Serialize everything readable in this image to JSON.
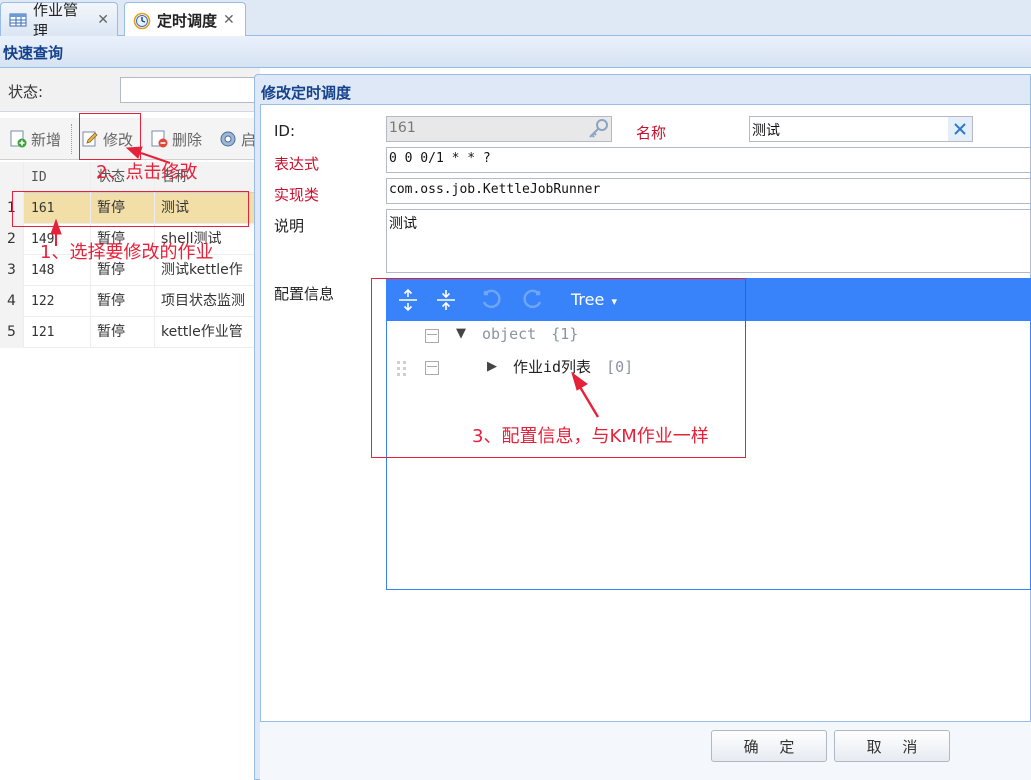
{
  "tabs": [
    {
      "label": "作业管理",
      "close": "✕",
      "icon": "grid-table-icon"
    },
    {
      "label": "定时调度",
      "close": "✕",
      "icon": "clock-icon",
      "active": true
    }
  ],
  "quick_query": {
    "title": "快速查询",
    "status_label": "状态:"
  },
  "toolbar": {
    "add_label": "新增",
    "edit_label": "修改",
    "delete_label": "删除",
    "start_label": "启"
  },
  "grid": {
    "columns": [
      "ID",
      "状态",
      "名称"
    ],
    "rows": [
      {
        "num": "1",
        "id": "161",
        "status": "暂停",
        "name": "测试",
        "selected": true
      },
      {
        "num": "2",
        "id": "149",
        "status": "暂停",
        "name": "shell测试"
      },
      {
        "num": "3",
        "id": "148",
        "status": "暂停",
        "name": "测试kettle作"
      },
      {
        "num": "4",
        "id": "122",
        "status": "暂停",
        "name": "项目状态监测"
      },
      {
        "num": "5",
        "id": "121",
        "status": "暂停",
        "name": "kettle作业管"
      }
    ]
  },
  "dialog": {
    "title": "修改定时调度",
    "id_label": "ID:",
    "id_value": "161",
    "name_label": "名称",
    "name_value": "测试",
    "expr_label": "表达式",
    "expr_value": "0 0 0/1 * * ?",
    "impl_label": "实现类",
    "impl_value": "com.oss.job.KettleJobRunner",
    "desc_label": "说明",
    "desc_value": "测试",
    "config_label": "配置信息",
    "editor": {
      "mode": "Tree",
      "mode_caret": "▾",
      "root_key": "object",
      "root_count": "{1}",
      "child_key": "作业id列表",
      "child_count": "[0]"
    },
    "ok_label": "确 定",
    "cancel_label": "取 消"
  },
  "annotations": {
    "step1": "1、选择要修改的作业",
    "step2": "2、点击修改",
    "step3": "3、配置信息，与KM作业一样"
  },
  "colors": {
    "accent": "#3883fa",
    "annotation": "#e6223a",
    "required_label": "#c8102e",
    "selected_row": "#f2dfa8",
    "panel_title": "#15428b"
  }
}
